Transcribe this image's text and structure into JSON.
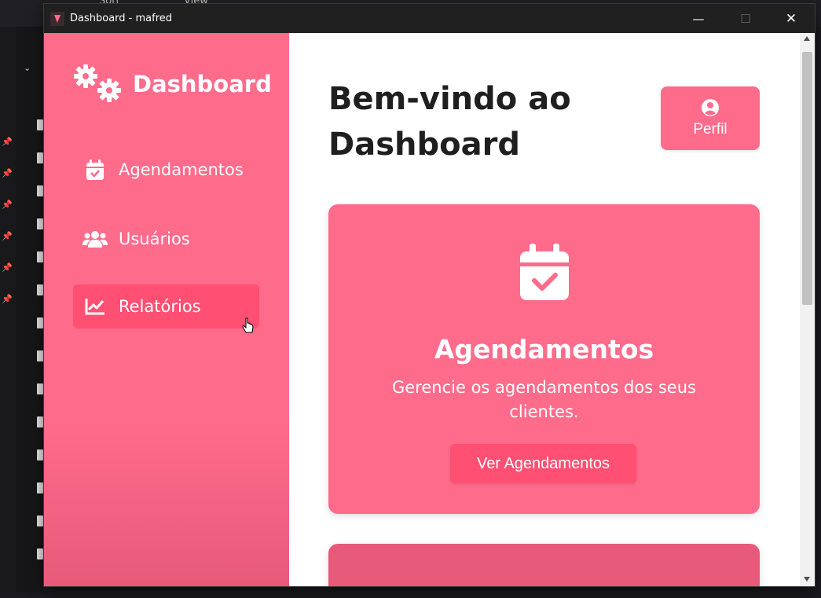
{
  "background": {
    "toolbar_items": [
      "Sort",
      "View"
    ]
  },
  "window": {
    "title": "Dashboard - mafred",
    "buttons": {
      "minimize": "—",
      "maximize": "☐",
      "close": "✕"
    }
  },
  "sidebar": {
    "brand": "Dashboard",
    "items": [
      {
        "label": "Agendamentos",
        "icon": "calendar-check-icon"
      },
      {
        "label": "Usuários",
        "icon": "users-icon"
      },
      {
        "label": "Relatórios",
        "icon": "chart-line-icon",
        "active": true
      }
    ]
  },
  "main": {
    "title": "Bem-vindo ao Dashboard",
    "profile_button": {
      "label": "Perfil",
      "icon": "user-circle-icon"
    },
    "cards": [
      {
        "title": "Agendamentos",
        "description": "Gerencie os agendamentos dos seus clientes.",
        "button": "Ver Agendamentos",
        "icon": "calendar-check-icon"
      }
    ]
  },
  "colors": {
    "accent": "#ff6b8b",
    "accent_dark": "#ff4f72",
    "title_text": "#1f1f1f",
    "titlebar": "#202020"
  }
}
